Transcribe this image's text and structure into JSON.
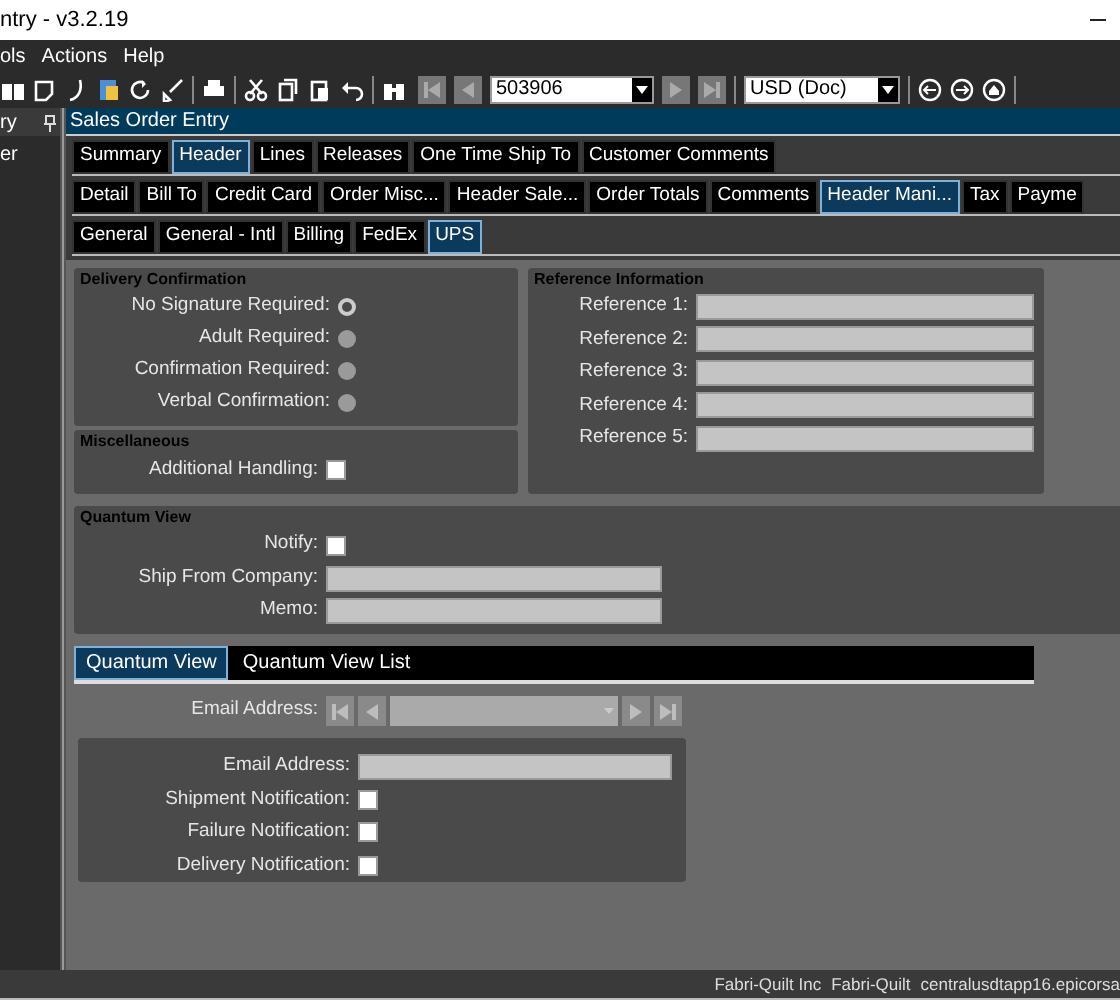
{
  "window": {
    "title": "ntry - v3.2.19"
  },
  "menu": [
    "ols",
    "Actions",
    "Help"
  ],
  "toolbar": {
    "record": "503906",
    "currency": "USD (Doc)"
  },
  "left_panel": {
    "title": "ry",
    "items": [
      "er"
    ]
  },
  "form_title": "Sales Order Entry",
  "tab_rows": [
    [
      {
        "label": "Summary",
        "selected": false
      },
      {
        "label": "Header",
        "selected": true
      },
      {
        "label": "Lines",
        "selected": false
      },
      {
        "label": "Releases",
        "selected": false
      },
      {
        "label": "One Time Ship To",
        "selected": false
      },
      {
        "label": "Customer Comments",
        "selected": false
      }
    ],
    [
      {
        "label": "Detail",
        "selected": false
      },
      {
        "label": "Bill To",
        "selected": false
      },
      {
        "label": "Credit Card",
        "selected": false
      },
      {
        "label": "Order Misc...",
        "selected": false
      },
      {
        "label": "Header  Sale...",
        "selected": false
      },
      {
        "label": "Order Totals",
        "selected": false
      },
      {
        "label": "Comments",
        "selected": false
      },
      {
        "label": "Header  Mani...",
        "selected": true
      },
      {
        "label": "Tax",
        "selected": false
      },
      {
        "label": "Payme",
        "selected": false
      }
    ],
    [
      {
        "label": "General",
        "selected": false
      },
      {
        "label": "General - Intl",
        "selected": false
      },
      {
        "label": "Billing",
        "selected": false
      },
      {
        "label": "FedEx",
        "selected": false
      },
      {
        "label": "UPS",
        "selected": true
      }
    ]
  ],
  "delivery_confirmation": {
    "title": "Delivery Confirmation",
    "options": [
      {
        "label": "No Signature Required:",
        "selected": true
      },
      {
        "label": "Adult Required:",
        "selected": false
      },
      {
        "label": "Confirmation Required:",
        "selected": false
      },
      {
        "label": "Verbal Confirmation:",
        "selected": false
      }
    ]
  },
  "miscellaneous": {
    "title": "Miscellaneous",
    "fields": [
      {
        "label": "Additional Handling:",
        "checked": false
      }
    ]
  },
  "reference_information": {
    "title": "Reference Information",
    "fields": [
      "Reference 1:",
      "Reference 2:",
      "Reference 3:",
      "Reference 4:",
      "Reference 5:"
    ]
  },
  "quantum_view": {
    "title": "Quantum View",
    "notify": {
      "label": "Notify:",
      "checked": false
    },
    "fields": [
      "Ship From Company:",
      "Memo:"
    ]
  },
  "quantum_tabs": [
    {
      "label": "Quantum View",
      "selected": true
    },
    {
      "label": "Quantum View List",
      "selected": false
    }
  ],
  "email_nav": {
    "label": "Email Address:"
  },
  "notification_fields": [
    {
      "kind": "text",
      "label": "Email Address:"
    },
    {
      "kind": "checkbox",
      "label": "Shipment Notification:",
      "checked": false
    },
    {
      "kind": "checkbox",
      "label": "Failure Notification:",
      "checked": false
    },
    {
      "kind": "checkbox",
      "label": "Delivery Notification:",
      "checked": false
    }
  ],
  "status_bar": [
    "Fabri-Quilt Inc",
    "Fabri-Quilt",
    "centralusdtapp16.epicorsa"
  ]
}
